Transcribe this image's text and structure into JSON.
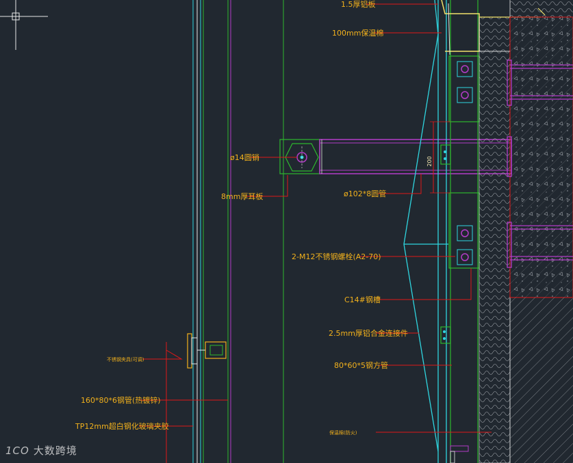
{
  "labels": {
    "l1": "1.5厚铝板",
    "l2": "100mm保温棉",
    "l3": "ø14圆销",
    "l4": "8mm厚耳板",
    "l5": "ø102*8圆管",
    "l6": "2-M12不锈钢螺栓(A2-70)",
    "l7": "C14#钢槽",
    "l8": "2.5mm厚铝合金连接件",
    "l9": "80*60*5钢方管",
    "l10": "不锈钢夹具(可调)",
    "l11": "160*80*6钢管(热镀锌)",
    "l12": "TP12mm超白钢化玻璃夹胶",
    "l13": "保温棉(防火)"
  },
  "dimension": "200",
  "watermark": {
    "logo": "1CO",
    "text": "大数跨境"
  },
  "colors": {
    "background": "#212830",
    "label": "#f2b11c",
    "leader": "#e01818",
    "cyan": "#2fd6e0",
    "green": "#2eb82e",
    "magenta": "#b43cc8",
    "white": "#e8e8e8"
  }
}
